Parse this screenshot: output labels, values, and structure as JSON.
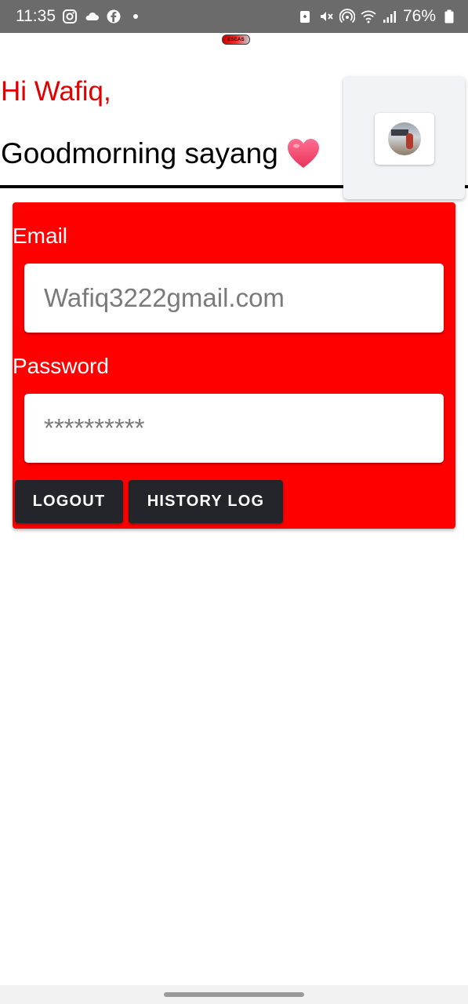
{
  "status_bar": {
    "time": "11:35",
    "battery": "76%",
    "left_icons": [
      "instagram-icon",
      "cloud-icon",
      "facebook-icon",
      "dot-icon"
    ],
    "right_icons": [
      "battery-saver-icon",
      "mute-icon",
      "hotspot-icon",
      "wifi-icon",
      "signal-icon",
      "battery-icon"
    ],
    "background": "#6b6b6b"
  },
  "logo": {
    "text": "ESEAS"
  },
  "greeting": {
    "hi": "Hi Wafiq,",
    "message": "Goodmorning sayang",
    "hi_color": "#e00000"
  },
  "profile": {
    "avatar": "profile-photo"
  },
  "form": {
    "background": "#ff0000",
    "email_label": "Email",
    "email_placeholder": "Wafiq3222gmail.com",
    "password_label": "Password",
    "password_placeholder": "**********",
    "logout_label": "LOGOUT",
    "history_label": "HISTORY LOG",
    "button_color": "#24252b"
  }
}
